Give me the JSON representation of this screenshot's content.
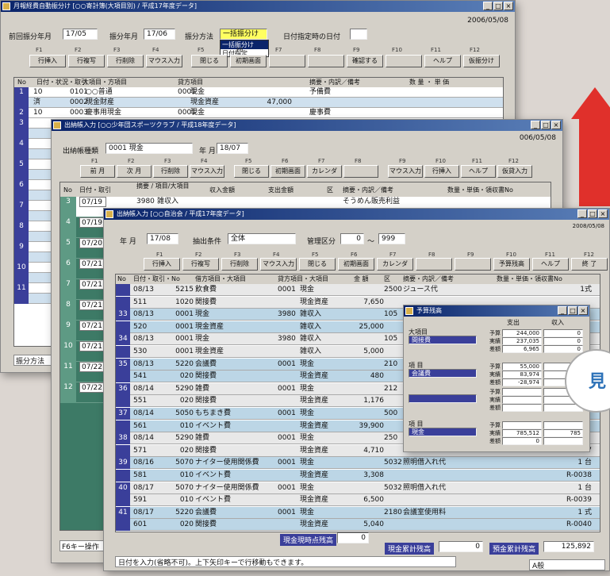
{
  "win1": {
    "title": "月報経費自動振分け [○○寄計簿(大項目別) / 平成17年度データ]",
    "date": "2006/05/08",
    "last_label": "前回振分年月",
    "last_val": "17/05",
    "this_label": "振分年月",
    "this_val": "17/06",
    "method_label": "振分方法",
    "method_val": "一括振分け",
    "method_opts": [
      "一括振分け",
      "日付指定"
    ],
    "date_label": "日付指定時の日付",
    "fkeys": [
      "F1",
      "F2",
      "F3",
      "F4",
      "F5",
      "F6",
      "F7",
      "F8",
      "F9",
      "F10",
      "F11",
      "F12"
    ],
    "buttons": [
      "行挿入",
      "行複写",
      "行削除",
      "マウス入力",
      "閉じる",
      "初期画面",
      "",
      "",
      "確認する",
      "",
      "ヘルプ",
      "仮振分け"
    ],
    "headers": [
      "No",
      "日付・状況・取引",
      "大項目・方項目",
      "貸方項目",
      "摘要・内訳／備考",
      "数 量 ・ 単 価"
    ],
    "rows": [
      {
        "no": "1",
        "a": "10",
        "b": "0101",
        "c": "○○普通",
        "d": "0001",
        "e": "現金",
        "f": "予備費",
        "amt": ""
      },
      {
        "no": "",
        "a": "済",
        "b": "0002",
        "c": "現金財産",
        "d": "",
        "e": "現金資産",
        "f": "",
        "amt": "47,000"
      },
      {
        "no": "2",
        "a": "10",
        "b": "0003",
        "c": "慶事用現金",
        "d": "0001",
        "e": "現金",
        "f": "慶事費",
        "amt": ""
      }
    ],
    "left_rows": [
      "3",
      "",
      "4",
      "",
      "5",
      "",
      "6",
      "",
      "7",
      "",
      "8",
      "",
      "9",
      "",
      "10",
      "",
      "11",
      ""
    ],
    "status": "振分方法"
  },
  "win2": {
    "title": "出納帳入力 [○○少年団スポーツクラブ / 平成18年度データ]",
    "date": "006/05/08",
    "book_label": "出納帳種類",
    "book_val": "0001 現金",
    "ym_label": "年 月",
    "ym_val": "18/07",
    "buttons": [
      "前 月",
      "次 月",
      "行削除",
      "マウス入力",
      "閉じる",
      "初期画面",
      "カレンダ",
      "",
      "マウス入力",
      "行挿入",
      "ヘルプ",
      "仮貸入力"
    ],
    "headers": [
      "No",
      "日付・取引",
      "摘要 / 項目/大項目",
      "収入金額",
      "支出金額",
      "区",
      "摘要・内訳／備考",
      "数量・単価・領収書No"
    ],
    "rows": [
      {
        "no": "3",
        "date": "07/19",
        "code": "3980",
        "item": "雑収入",
        "note": "そうめん販売利益"
      },
      {
        "no": "4",
        "date": "07/19"
      },
      {
        "no": "5",
        "date": "07/20"
      },
      {
        "no": "6",
        "date": "07/21"
      },
      {
        "no": "7",
        "date": "07/21"
      },
      {
        "no": "8",
        "date": "07/21"
      },
      {
        "no": "9",
        "date": "07/21"
      },
      {
        "no": "10",
        "date": "07/21"
      },
      {
        "no": "11",
        "date": "07/22"
      },
      {
        "no": "12",
        "date": "07/22"
      }
    ],
    "status": "F6キー操作"
  },
  "win3": {
    "title": "出納帳入力 [○○自治会 / 平成17年度データ]",
    "date": "2008/05/08",
    "ym_label": "年 月",
    "ym_val": "17/08",
    "cond_label": "抽出条件",
    "cond_val": "全体",
    "kubun_label": "管理区分",
    "k1": "0",
    "tilde": "〜",
    "k2": "999",
    "fkeys": [
      "F1",
      "F2",
      "F3",
      "F4",
      "F5",
      "F6",
      "F7",
      "F8",
      "F9",
      "F10",
      "F11",
      "F12"
    ],
    "buttons": [
      "行挿入",
      "行複写",
      "行削除",
      "マウス入力",
      "閉じる",
      "初期画面",
      "カレンダ",
      "",
      "",
      "予算残高",
      "ヘルプ",
      "終 了"
    ],
    "headers": [
      "No",
      "日付・取引・No",
      "借方項目・大項目",
      "貸方項目・大項目",
      "金 額",
      "区",
      "摘要・内訳／備考",
      "数量・単価・領収書No"
    ],
    "rows": [
      {
        "no": "",
        "date": "08/13",
        "c1": "5215",
        "t1": "飲食費",
        "c2": "0001",
        "t2": "現金",
        "amt": "",
        "k": "2500",
        "memo": "ジュース代",
        "qty": "1式"
      },
      {
        "no": "",
        "date": "511",
        "c1": "1020",
        "t1": "関接費",
        "c2": "",
        "t2": "現金資産",
        "amt": "7,650",
        "k": "",
        "memo": "",
        "qty": ""
      },
      {
        "no": "33",
        "date": "08/13",
        "c1": "0001",
        "t1": "現金",
        "c2": "3980",
        "t2": "雑収入",
        "amt": "",
        "k": "105",
        "memo": "",
        "qty": ""
      },
      {
        "no": "",
        "date": "520",
        "c1": "0001",
        "t1": "現金資産",
        "c2": "",
        "t2": "雑収入",
        "amt": "25,000",
        "k": "",
        "memo": "",
        "qty": ""
      },
      {
        "no": "34",
        "date": "08/13",
        "c1": "0001",
        "t1": "現金",
        "c2": "3980",
        "t2": "雑収入",
        "amt": "",
        "k": "105",
        "memo": "",
        "qty": ""
      },
      {
        "no": "",
        "date": "530",
        "c1": "0001",
        "t1": "現金資産",
        "c2": "",
        "t2": "雑収入",
        "amt": "5,000",
        "k": "",
        "memo": "",
        "qty": ""
      },
      {
        "no": "35",
        "date": "08/13",
        "c1": "5220",
        "t1": "会議費",
        "c2": "0001",
        "t2": "現金",
        "amt": "",
        "k": "210",
        "memo": "",
        "qty": ""
      },
      {
        "no": "",
        "date": "541",
        "c1": "020",
        "t1": "関接費",
        "c2": "",
        "t2": "現金資産",
        "amt": "480",
        "k": "",
        "memo": "",
        "qty": ""
      },
      {
        "no": "36",
        "date": "08/14",
        "c1": "5290",
        "t1": "雑費",
        "c2": "0001",
        "t2": "現金",
        "amt": "",
        "k": "212",
        "memo": "",
        "qty": ""
      },
      {
        "no": "",
        "date": "551",
        "c1": "020",
        "t1": "関接費",
        "c2": "",
        "t2": "現金資産",
        "amt": "1,176",
        "k": "",
        "memo": "",
        "qty": ""
      },
      {
        "no": "37",
        "date": "08/14",
        "c1": "5050",
        "t1": "もちまき費",
        "c2": "0001",
        "t2": "現金",
        "amt": "",
        "k": "500",
        "memo": "",
        "qty": ""
      },
      {
        "no": "",
        "date": "561",
        "c1": "010",
        "t1": "イベント費",
        "c2": "",
        "t2": "現金資産",
        "amt": "39,900",
        "k": "",
        "memo": "",
        "qty": ""
      },
      {
        "no": "38",
        "date": "08/14",
        "c1": "5290",
        "t1": "雑費",
        "c2": "0001",
        "t2": "現金",
        "amt": "",
        "k": "250",
        "memo": "",
        "qty": ""
      },
      {
        "no": "",
        "date": "571",
        "c1": "020",
        "t1": "関接費",
        "c2": "",
        "t2": "現金資産",
        "amt": "4,710",
        "k": "",
        "memo": "",
        "qty": "R-0037"
      },
      {
        "no": "39",
        "date": "08/16",
        "c1": "5070",
        "t1": "ナイター使用関係費",
        "c2": "0001",
        "t2": "現金",
        "amt": "",
        "k": "5032",
        "memo": "照明借入れ代",
        "qty": "1 台"
      },
      {
        "no": "",
        "date": "581",
        "c1": "010",
        "t1": "イベント費",
        "c2": "",
        "t2": "現金資産",
        "amt": "3,308",
        "k": "",
        "memo": "",
        "qty": "R-0038"
      },
      {
        "no": "40",
        "date": "08/17",
        "c1": "5070",
        "t1": "ナイター使用関係費",
        "c2": "0001",
        "t2": "現金",
        "amt": "",
        "k": "5032",
        "memo": "照明借入れ代",
        "qty": "1 台"
      },
      {
        "no": "",
        "date": "591",
        "c1": "010",
        "t1": "イベント費",
        "c2": "",
        "t2": "現金資産",
        "amt": "6,500",
        "k": "",
        "memo": "",
        "qty": "R-0039"
      },
      {
        "no": "41",
        "date": "08/17",
        "c1": "5220",
        "t1": "会議費",
        "c2": "0001",
        "t2": "現金",
        "amt": "",
        "k": "2180",
        "memo": "会議室使用料",
        "qty": "1 式"
      },
      {
        "no": "",
        "date": "601",
        "c1": "020",
        "t1": "関接費",
        "c2": "",
        "t2": "現金資産",
        "amt": "5,040",
        "k": "",
        "memo": "",
        "qty": "R-0040"
      }
    ],
    "bal1_label": "現金現時点残高",
    "bal1": "0",
    "bal2_label": "現金累計残高",
    "bal2": "0",
    "bal3_label": "預金累計残高",
    "bal3": "125,892",
    "status": "日付を入力(省略不可)。上下矢印キーで行移動もできます。",
    "taskbar": "A般"
  },
  "popup": {
    "title": "予算残高",
    "col1": "支出",
    "col2": "収入",
    "s1_label": "大項目",
    "s1_val": "間接費",
    "s1": [
      [
        "予算",
        "244,000",
        "0"
      ],
      [
        "実績",
        "237,035",
        "0"
      ],
      [
        "差額",
        "6,965",
        "0"
      ]
    ],
    "s2_label": "項 目",
    "s2_val": "会議費",
    "s2": [
      [
        "予算",
        "55,000",
        "0"
      ],
      [
        "実績",
        "83,974",
        "0"
      ],
      [
        "差額",
        "-28,974",
        "0"
      ]
    ],
    "s3": [
      [
        "予算",
        "",
        ""
      ],
      [
        "実績",
        "",
        ""
      ],
      [
        "差額",
        "",
        ""
      ]
    ],
    "s4_label": "項 目",
    "s4_val": "現金",
    "s4": [
      [
        "予算",
        "",
        ""
      ],
      [
        "実績",
        "785,512",
        "785"
      ],
      [
        "差額",
        "0",
        ""
      ]
    ]
  },
  "callout": "見"
}
